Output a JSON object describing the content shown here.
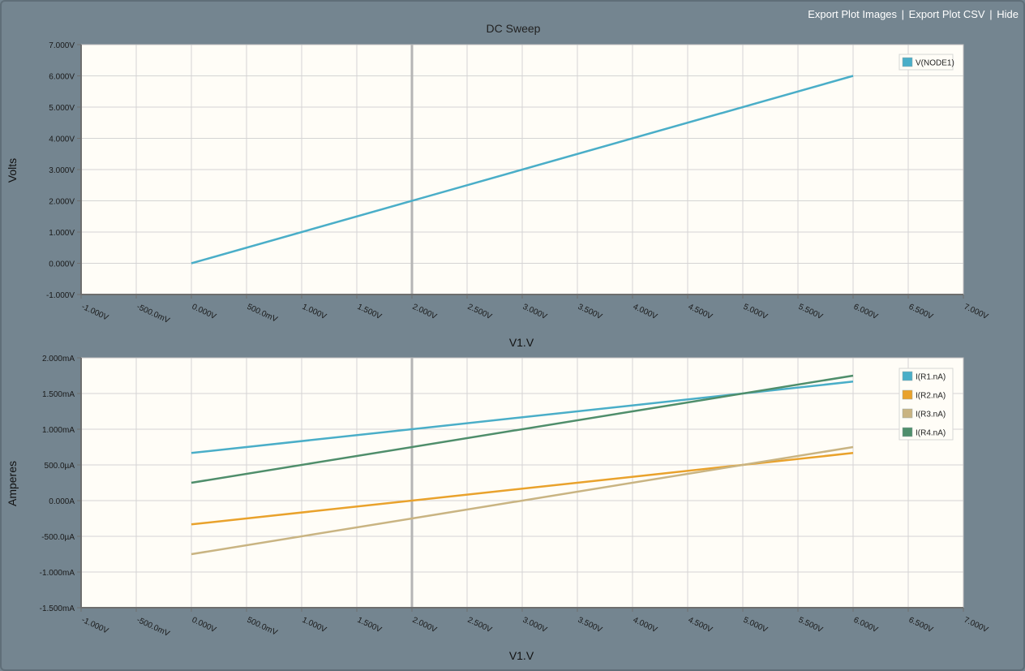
{
  "toolbar": {
    "export_images": "Export Plot Images",
    "export_csv": "Export Plot CSV",
    "hide": "Hide",
    "separator": "|"
  },
  "colors": {
    "background": "#748590",
    "plot_bg": "#fffdf7",
    "series": [
      "#4aaec8",
      "#e9a22c",
      "#c9b482",
      "#4f8e6b"
    ]
  },
  "chart_data": [
    {
      "type": "line",
      "title": "DC Sweep",
      "xlabel": "V1.V",
      "ylabel": "Volts",
      "xlim": [
        -1.0,
        7.0
      ],
      "ylim": [
        -1.0,
        7.0
      ],
      "xticks": [
        -1.0,
        -0.5,
        0.0,
        0.5,
        1.0,
        1.5,
        2.0,
        2.5,
        3.0,
        3.5,
        4.0,
        4.5,
        5.0,
        5.5,
        6.0,
        6.5,
        7.0
      ],
      "xtick_labels": [
        "-1.000V",
        "-500.0mV",
        "0.000V",
        "500.0mV",
        "1.000V",
        "1.500V",
        "2.000V",
        "2.500V",
        "3.000V",
        "3.500V",
        "4.000V",
        "4.500V",
        "5.000V",
        "5.500V",
        "6.000V",
        "6.500V",
        "7.000V"
      ],
      "yticks": [
        -1,
        0,
        1,
        2,
        3,
        4,
        5,
        6,
        7
      ],
      "ytick_labels": [
        "-1.000V",
        "0.000V",
        "1.000V",
        "2.000V",
        "3.000V",
        "4.000V",
        "5.000V",
        "6.000V",
        "7.000V"
      ],
      "cursor_x": 2.0,
      "legend_position": "top-right",
      "series": [
        {
          "name": "V(NODE1)",
          "x": [
            0,
            6
          ],
          "y": [
            0.0,
            6.0
          ]
        }
      ]
    },
    {
      "type": "line",
      "title": "",
      "xlabel": "V1.V",
      "ylabel": "Amperes",
      "xlim": [
        -1.0,
        7.0
      ],
      "ylim": [
        -1.5,
        2.0
      ],
      "xticks": [
        -1.0,
        -0.5,
        0.0,
        0.5,
        1.0,
        1.5,
        2.0,
        2.5,
        3.0,
        3.5,
        4.0,
        4.5,
        5.0,
        5.5,
        6.0,
        6.5,
        7.0
      ],
      "xtick_labels": [
        "-1.000V",
        "-500.0mV",
        "0.000V",
        "500.0mV",
        "1.000V",
        "1.500V",
        "2.000V",
        "2.500V",
        "3.000V",
        "3.500V",
        "4.000V",
        "4.500V",
        "5.000V",
        "5.500V",
        "6.000V",
        "6.500V",
        "7.000V"
      ],
      "yticks": [
        -1.5,
        -1.0,
        -0.5,
        0.0,
        0.5,
        1.0,
        1.5,
        2.0
      ],
      "ytick_labels": [
        "-1.500mA",
        "-1.000mA",
        "-500.0µA",
        "0.000A",
        "500.0µA",
        "1.000mA",
        "1.500mA",
        "2.000mA"
      ],
      "cursor_x": 2.0,
      "legend_position": "top-right",
      "series": [
        {
          "name": "I(R1.nA)",
          "x": [
            0,
            6
          ],
          "y": [
            0.667,
            1.667
          ]
        },
        {
          "name": "I(R2.nA)",
          "x": [
            0,
            6
          ],
          "y": [
            -0.333,
            0.667
          ]
        },
        {
          "name": "I(R3.nA)",
          "x": [
            0,
            6
          ],
          "y": [
            -0.75,
            0.75
          ]
        },
        {
          "name": "I(R4.nA)",
          "x": [
            0,
            6
          ],
          "y": [
            0.25,
            1.75
          ]
        }
      ]
    }
  ]
}
